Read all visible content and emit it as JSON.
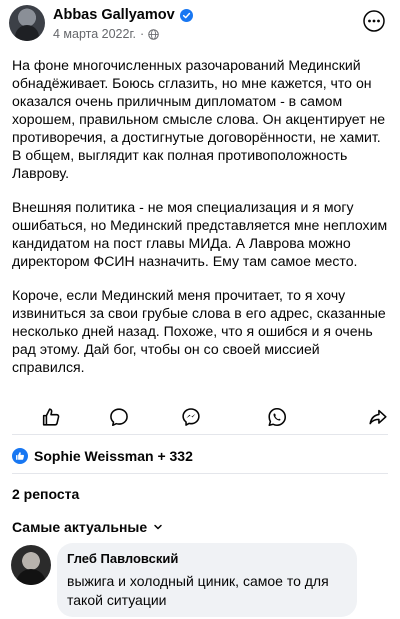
{
  "post": {
    "author": "Abbas Gallyamov",
    "date": "4 марта 2022г.",
    "date_separator": "·",
    "paragraphs": [
      "На фоне многочисленных разочарований Мединский обнадёживает. Боюсь сглазить, но мне кажется, что он оказался очень приличным дипломатом - в самом хорошем, правильном смысле слова. Он акцентирует не противоречия, а достигнутые договорённости, не хамит. В общем, выглядит как полная противоположность Лаврову.",
      "Внешняя политика - не моя специализация и я могу ошибаться, но Мединский представляется мне неплохим кандидатом на пост главы МИДа. А Лаврова можно директором ФСИН назначить. Ему там самое место.",
      "Короче, если Мединский меня прочитает, то я хочу извиниться за свои грубые слова в его адрес, сказанные несколько дней назад. Похоже, что я ошибся и я очень рад этому. Дай бог, чтобы он со своей миссией справился."
    ]
  },
  "actions": [
    "like-icon",
    "comment-icon",
    "send-icon",
    "whatsapp-icon",
    "share-icon"
  ],
  "reactions": {
    "label": "Sophie Weissman + 332"
  },
  "reposts": {
    "label": "2 репоста"
  },
  "comments": {
    "sort_label": "Самые актуальные",
    "items": [
      {
        "author": "Глеб Павловский",
        "text": "выжига и холодный циник, самое то для такой ситуации"
      }
    ]
  },
  "colors": {
    "accent": "#1877f2",
    "muted": "#65676b",
    "bubble": "#f0f2f5",
    "divider": "#e4e6eb"
  }
}
